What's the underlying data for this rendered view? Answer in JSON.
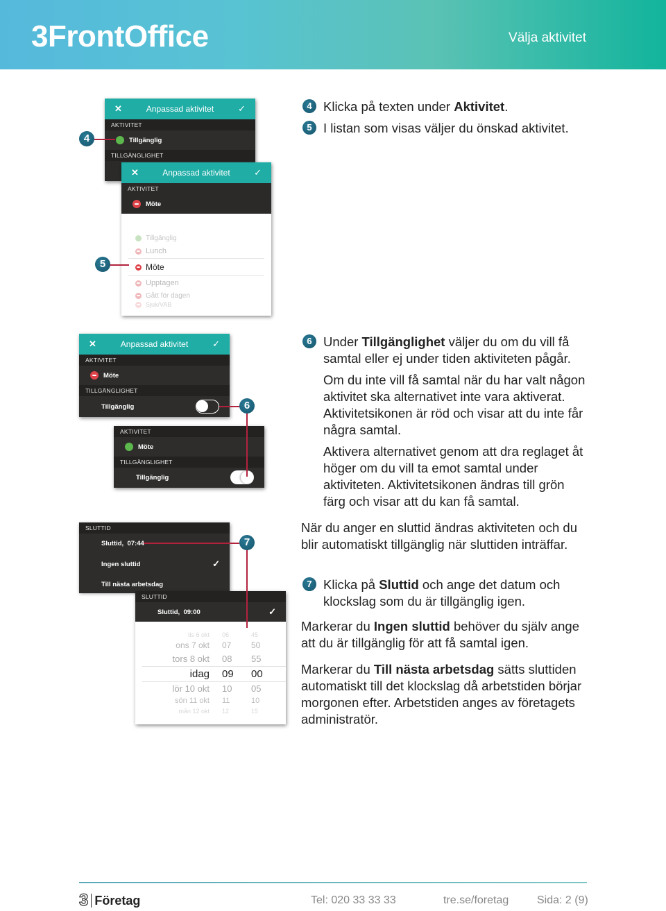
{
  "header": {
    "title": "3FrontOffice",
    "section": "Välja aktivitet"
  },
  "colors": {
    "accent": "#1fada6",
    "badge": "#16546c",
    "callout_line": "#b3223d",
    "available": "#5cb84c",
    "busy": "#e0424a"
  },
  "mock1": {
    "bar_title": "Anpassad aktivitet",
    "section_activity": "AKTIVITET",
    "activity_value": "Tillgänglig",
    "section_availability": "TILLGÄNGLIGHET"
  },
  "mock2": {
    "bar_title": "Anpassad aktivitet",
    "section_activity": "AKTIVITET",
    "activity_value": "Möte",
    "list": [
      "Tillgänglig",
      "Lunch",
      "Möte",
      "Upptagen",
      "Gått för dagen",
      "Sjuk/VAB"
    ],
    "selected": "Möte"
  },
  "mock3": {
    "bar_title": "Anpassad aktivitet",
    "section_activity": "AKTIVITET",
    "activity_value": "Möte",
    "section_availability": "TILLGÄNGLIGHET",
    "toggle_label": "Tillgänglig",
    "toggle_on": false
  },
  "mock4": {
    "section_activity": "AKTIVITET",
    "activity_value": "Möte",
    "section_availability": "TILLGÄNGLIGHET",
    "toggle_label": "Tillgänglig",
    "toggle_on": true
  },
  "mock5": {
    "section": "SLUTTID",
    "end_time": "Sluttid,  07:44",
    "no_end": "Ingen sluttid",
    "next_day": "Till nästa arbetsdag"
  },
  "mock6": {
    "section": "SLUTTID",
    "end_time": "Sluttid,  09:00",
    "picker": [
      {
        "day": "tis 6 okt",
        "hour": "06",
        "min": "45"
      },
      {
        "day": "ons 7 okt",
        "hour": "07",
        "min": "50"
      },
      {
        "day": "tors 8 okt",
        "hour": "08",
        "min": "55"
      },
      {
        "day": "idag",
        "hour": "09",
        "min": "00"
      },
      {
        "day": "lör 10 okt",
        "hour": "10",
        "min": "05"
      },
      {
        "day": "sön 11 okt",
        "hour": "11",
        "min": "10"
      },
      {
        "day": "mån 12 okt",
        "hour": "12",
        "min": "15"
      }
    ]
  },
  "badges": {
    "b4": "4",
    "b5": "5",
    "b6": "6",
    "b7": "7"
  },
  "steps": {
    "s4_pre": "Klicka på texten under ",
    "s4_bold": "Aktivitet",
    "s4_post": ".",
    "s5": "I listan som visas väljer du önskad aktivitet.",
    "s6_pre": "Under ",
    "s6_bold": "Tillgänglighet",
    "s6_post": " väljer du om du vill få samtal eller ej under tiden aktiviteten pågår.",
    "s6_p2": "Om du inte vill få samtal när du har valt någon aktivitet ska alternativet inte vara aktiverat. Aktivitetsikonen är röd och visar att du inte får några samtal.",
    "s6_p3": "Aktivera alternativet genom att dra reglaget åt höger om du vill ta emot samtal under aktiviteten. Aktivitetsikonen ändras till grön färg och visar att du kan få samtal.",
    "intro7": "När du anger en sluttid ändras aktiviteten och du blir automatiskt tillgänglig när sluttiden inträffar.",
    "s7_pre": "Klicka på ",
    "s7_bold": "Sluttid",
    "s7_post": " och ange det datum och klockslag som du är tillgänglig igen.",
    "p_ingen_pre": "Markerar du ",
    "p_ingen_bold": "Ingen sluttid",
    "p_ingen_post": " behöver du själv ange att du är tillgänglig för att få samtal igen.",
    "p_till_pre": "Markerar du ",
    "p_till_bold": "Till nästa arbetsdag",
    "p_till_post": " sätts sluttiden automatiskt till det klockslag då arbetstiden börjar morgonen efter. Arbetstiden anges av företagets administratör."
  },
  "footer": {
    "logo_word": "Företag",
    "phone": "Tel: 020 33 33 33",
    "web": "tre.se/foretag",
    "page": "Sida: 2 (9)"
  }
}
